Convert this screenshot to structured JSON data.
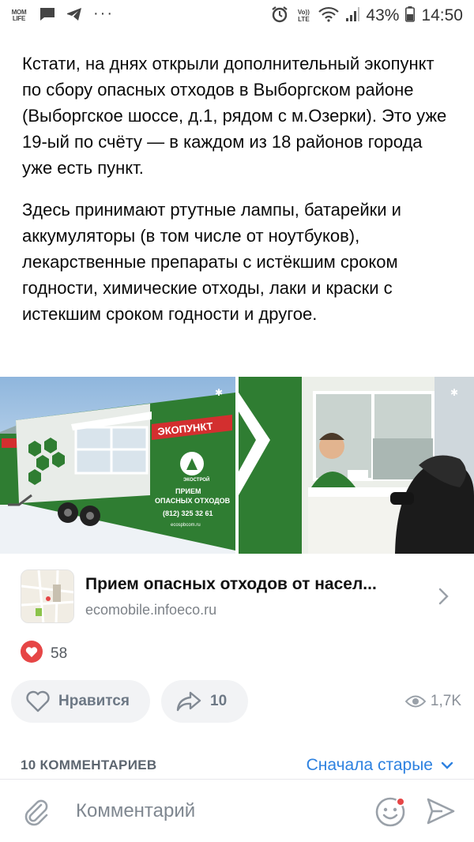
{
  "status_bar": {
    "momlife": "MOM LIFE",
    "dots": "···",
    "volte": "Vo)) LTE",
    "battery": "43%",
    "time": "14:50"
  },
  "post": {
    "paragraph_1": "Кстати, на днях открыли дополнительный экопункт по сбору опасных отходов в Выборгском районе (Выборгское шоссе, д.1, рядом с м.Озерки). Это уже 19-ый по счёту — в каждом из 18 районов города уже есть пункт.",
    "paragraph_2": "Здесь принимают ртутные лампы, батарейки и аккумуляторы (в том числе от ноутбуков), лекарственные препараты с истёкшим сроком годности, химические отходы, лаки и краски с истекшим сроком годности и другое."
  },
  "photos": {
    "left": {
      "banner": "ЭКОПУНКТ",
      "sign_1": "ПРИЕМ",
      "sign_2": "ОПАСНЫХ ОТХОДОВ",
      "phone": "(812) 325 32 61",
      "site": "ecospbcom.ru",
      "logo_text": "ЭКОСТРОЙ"
    }
  },
  "link": {
    "title": "Прием опасных отходов от насел...",
    "domain": "ecomobile.infoeco.ru"
  },
  "likes": {
    "count": "58"
  },
  "actions": {
    "like_label": "Нравится",
    "share_count": "10",
    "views": "1,7K"
  },
  "comments": {
    "count_label": "10 КОММЕНТАРИЕВ",
    "sort_label": "Сначала старые"
  },
  "comment_input": {
    "placeholder": "Комментарий"
  },
  "colors": {
    "accent": "#2d81e0",
    "like_red": "#e64646",
    "booth_green": "#2f7d32",
    "banner_red": "#d32f2f"
  }
}
